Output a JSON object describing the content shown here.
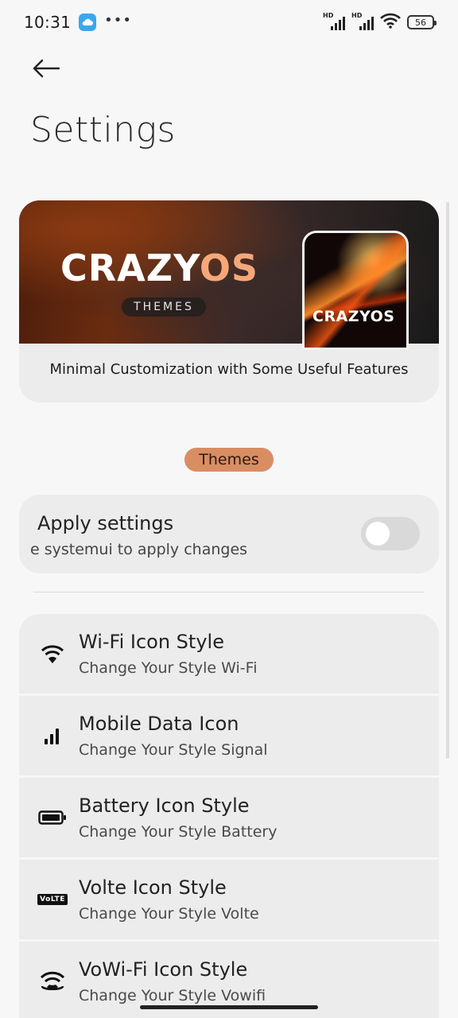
{
  "status_bar": {
    "time": "10:31",
    "dots": "•••",
    "battery": "56",
    "hd1": "HD",
    "hd2": "HD"
  },
  "header": {
    "title": "Settings"
  },
  "banner": {
    "brand_main": "CRAZY",
    "brand_accent": "OS",
    "brand_tag": "THEMES",
    "phone_brand": "CRAZYOS",
    "caption": "Minimal Customization with Some Useful Features"
  },
  "section": {
    "label": "Themes"
  },
  "apply": {
    "title": "Apply settings",
    "subtitle": "e systemui to apply changes",
    "toggle_on": false
  },
  "items": [
    {
      "title": "Wi-Fi Icon Style",
      "subtitle": "Change Your Style Wi-Fi",
      "icon": "wifi-icon"
    },
    {
      "title": "Mobile Data Icon",
      "subtitle": "Change Your Style Signal",
      "icon": "signal-icon"
    },
    {
      "title": "Battery Icon Style",
      "subtitle": "Change Your Style Battery",
      "icon": "battery-icon"
    },
    {
      "title": "Volte Icon Style",
      "subtitle": "Change Your Style Volte",
      "icon": "volte-icon",
      "badge": "VoLTE"
    },
    {
      "title": "VoWi-Fi Icon Style",
      "subtitle": "Change Your Style Vowifi",
      "icon": "vowifi-icon"
    }
  ],
  "colors": {
    "accent": "#d98d63",
    "card": "#ececec",
    "background": "#f7f7f7"
  }
}
